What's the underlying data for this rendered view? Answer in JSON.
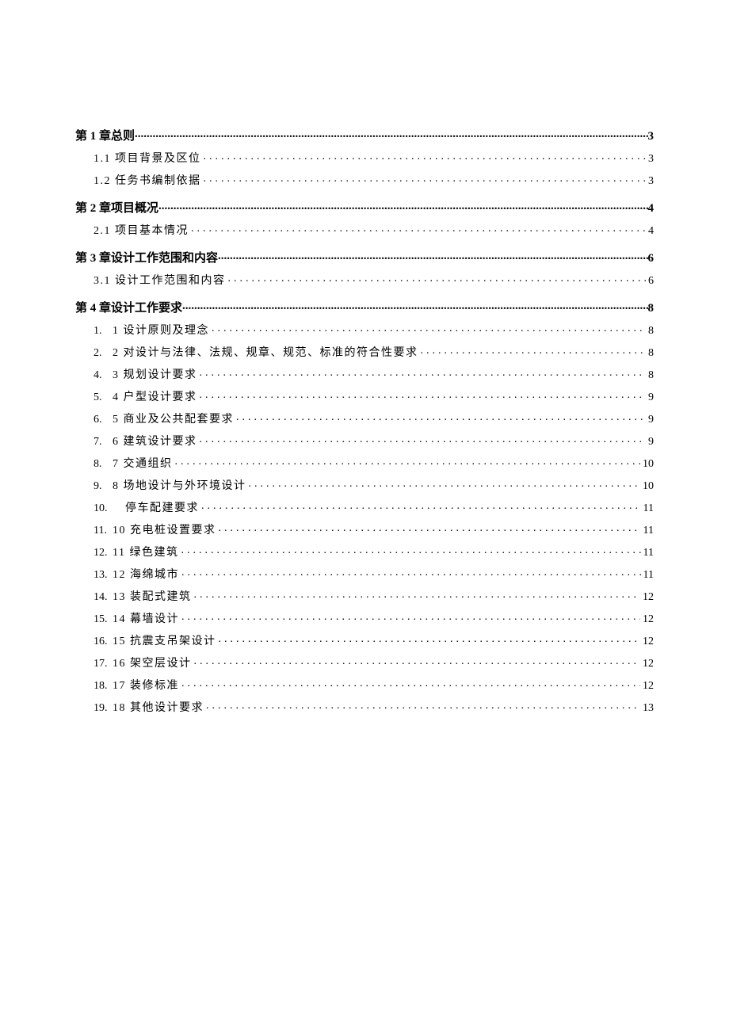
{
  "chapters": [
    {
      "title": "第 1 章总则",
      "page": "3",
      "subs": [
        {
          "title": "1.1 项目背景及区位",
          "page": "3"
        },
        {
          "title": "1.2 任务书编制依据",
          "page": "3"
        }
      ]
    },
    {
      "title": "第 2 章项目概况",
      "page": "4",
      "subs": [
        {
          "title": "2.1 项目基本情况",
          "page": "4"
        }
      ]
    },
    {
      "title": "第 3 章设计工作范围和内容",
      "page": "6",
      "subs": [
        {
          "title": "3.1 设计工作范围和内容",
          "page": "6"
        }
      ]
    },
    {
      "title": "第 4 章设计工作要求",
      "page": "8",
      "numbered": [
        {
          "num": "1.",
          "title": "1 设计原则及理念",
          "page": "8"
        },
        {
          "num": "2.",
          "title": "2 对设计与法律、法规、规章、规范、标准的符合性要求",
          "page": "8"
        },
        {
          "num": "4.",
          "title": "3 规划设计要求",
          "page": "8"
        },
        {
          "num": "5.",
          "title": "4 户型设计要求",
          "page": "9"
        },
        {
          "num": "6.",
          "title": "5 商业及公共配套要求",
          "page": "9"
        },
        {
          "num": "7.",
          "title": "6 建筑设计要求",
          "page": "9"
        },
        {
          "num": "8.",
          "title": "7 交通组织",
          "page": "10"
        },
        {
          "num": "9.",
          "title": "8 场地设计与外环境设计",
          "page": "10"
        },
        {
          "num": "10.",
          "title": "停车配建要求",
          "page": "11",
          "wide": true
        },
        {
          "num": "11.",
          "title": "10 充电桩设置要求",
          "page": "11"
        },
        {
          "num": "12.",
          "title": "11 绿色建筑",
          "page": "11"
        },
        {
          "num": "13.",
          "title": "12 海绵城市",
          "page": "11"
        },
        {
          "num": "14.",
          "title": "13 装配式建筑",
          "page": "12"
        },
        {
          "num": "15.",
          "title": "14 幕墙设计",
          "page": "12"
        },
        {
          "num": "16.",
          "title": "15 抗震支吊架设计",
          "page": "12"
        },
        {
          "num": "17.",
          "title": "16 架空层设计",
          "page": "12"
        },
        {
          "num": "18.",
          "title": "17 装修标准",
          "page": "12"
        },
        {
          "num": "19.",
          "title": "18 其他设计要求",
          "page": "13"
        }
      ]
    }
  ]
}
